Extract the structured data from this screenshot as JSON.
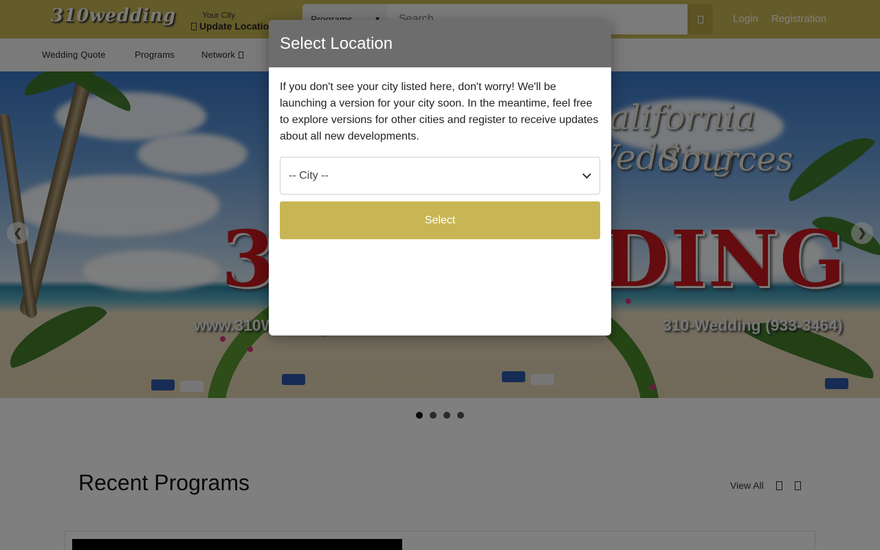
{
  "header": {
    "logo": "310wedding",
    "city_label": "Your City",
    "city_value": "Update Location",
    "search_category": "Programs",
    "search_placeholder": "Search",
    "login": "Login",
    "registration": "Registration"
  },
  "nav": {
    "items": [
      {
        "label": "Wedding Quote"
      },
      {
        "label": "Programs"
      },
      {
        "label": "Network"
      }
    ]
  },
  "banner": {
    "title_line1": "California Wedding",
    "title_line2": "Sources",
    "big_text": "310WEDDING",
    "website": "www.310Wedding.com",
    "phone": "310-Wedding (933-3464)"
  },
  "slider": {
    "slide_count": 4,
    "active_index": 0
  },
  "recent": {
    "title": "Recent Programs",
    "view_all": "View All"
  },
  "modal": {
    "title": "Select Location",
    "text": "If you don't see your city listed here, don't worry! We'll be launching a version for your city soon. In the meantime, feel free to explore versions for other cities and register to receive updates about all new developments.",
    "city_select": "-- City --",
    "select_button": "Select"
  },
  "colors": {
    "brand_gold": "#c8b654",
    "modal_header": "#6d6d6d",
    "banner_red": "#c8181e"
  }
}
